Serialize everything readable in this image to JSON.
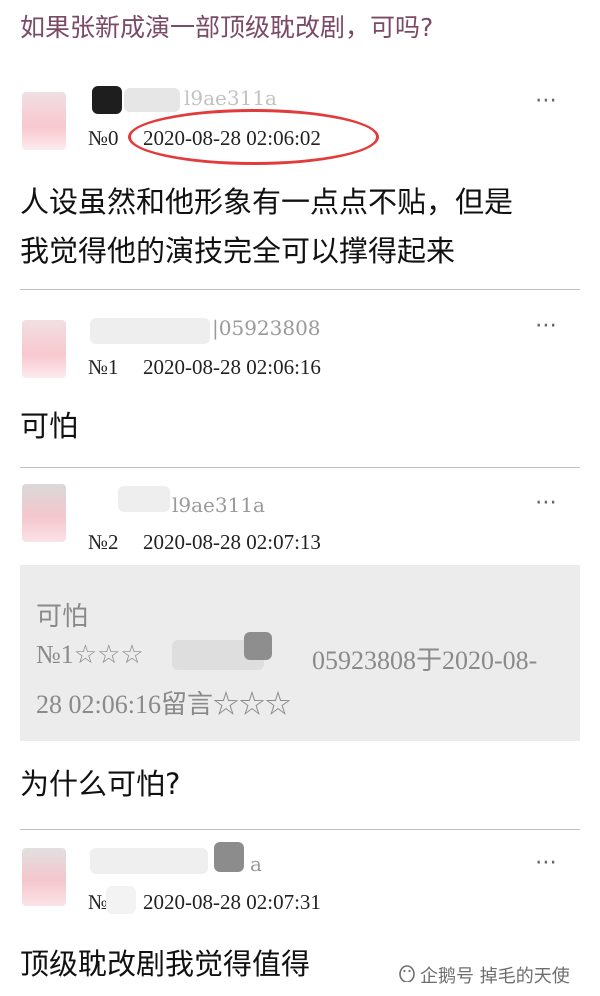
{
  "header": {
    "title": "如果张新成演一部顶级耽改剧，可吗?"
  },
  "more_icon": "⋯",
  "comments": [
    {
      "username": "l9ae311a",
      "floor": "№0",
      "time": "2020-08-28 02:06:02",
      "body_lines": [
        "人设虽然和他形象有一点点不贴，但是",
        "我觉得他的演技完全可以撑得起来"
      ]
    },
    {
      "username": "|05923808",
      "floor": "№1",
      "time": "2020-08-28 02:06:16",
      "body_lines": [
        "可怕"
      ]
    },
    {
      "username": "l9ae311a",
      "floor": "№2",
      "time": "2020-08-28 02:07:13",
      "quote": {
        "lines": [
          "可怕",
          "№1☆☆☆",
          "05923808于2020-08-",
          "28 02:06:16留言☆☆☆"
        ]
      },
      "body_lines": [
        "为什么可怕?"
      ]
    },
    {
      "username": "a",
      "floor": "№",
      "time": "2020-08-28 02:07:31",
      "body_lines": [
        "顶级耽改剧我觉得值得"
      ]
    }
  ],
  "watermark": {
    "text": "企鹅号 掉毛的天使",
    "icon": "penguin-icon"
  },
  "colors": {
    "title": "#7a4a66",
    "highlight_circle": "#e23b3b",
    "quote_bg": "#ececec"
  }
}
